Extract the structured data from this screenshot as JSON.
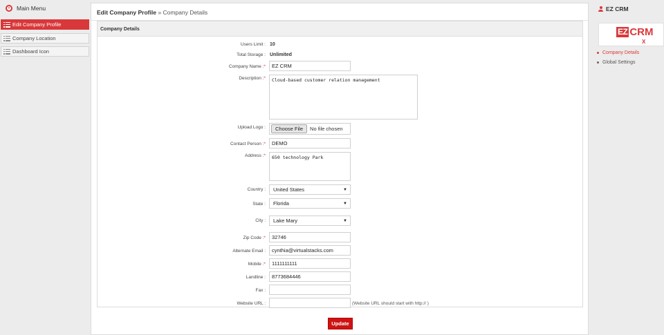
{
  "sidebar": {
    "menu_title": "Main Menu",
    "items": [
      {
        "label": "Edit Company Profile"
      },
      {
        "label": "Company Location"
      },
      {
        "label": "Dashboard Icon"
      }
    ]
  },
  "breadcrumb": {
    "current": "Edit Company Profile",
    "separator": "»",
    "sub": "Company Details"
  },
  "section": {
    "title": "Company Details"
  },
  "form": {
    "users_limit": {
      "label": "Users Limit :",
      "value": "10"
    },
    "total_storage": {
      "label": "Total Storage :",
      "value": "Unlimited"
    },
    "company_name": {
      "label": "Company Name :",
      "value": "EZ CRM"
    },
    "description": {
      "label": "Description :",
      "value": "Cloud-based customer relation management"
    },
    "upload_logo": {
      "label": "Upload Logo :",
      "button": "Choose File",
      "status": "No file chosen"
    },
    "contact_person": {
      "label": "Contact Person :",
      "value": "DEMO"
    },
    "address": {
      "label": "Address :",
      "value": "650 technology Park"
    },
    "country": {
      "label": "Country :",
      "value": "United States"
    },
    "state": {
      "label": "State :",
      "value": "Florida"
    },
    "city": {
      "label": "City :",
      "value": "Lake Mary"
    },
    "zip": {
      "label": "Zip Code :",
      "value": "32746"
    },
    "alt_email": {
      "label": "Alternate Email :",
      "value": "cynthia@virtualstacks.com"
    },
    "mobile": {
      "label": "Mobile :",
      "value": "1111111111"
    },
    "landline": {
      "label": "Landline :",
      "value": "8773684446"
    },
    "fax": {
      "label": "Fax :",
      "value": ""
    },
    "website": {
      "label": "Website URL :",
      "value": "",
      "hint": "(Website URL should start with http:// )"
    },
    "required_mark": "*",
    "update_label": "Update"
  },
  "right_panel": {
    "title": "EZ CRM",
    "logo_left": "EZ",
    "logo_right": "CRM",
    "logo_close": "X",
    "links": [
      {
        "label": "Company Details"
      },
      {
        "label": "Global Settings"
      }
    ]
  },
  "colors": {
    "accent": "#d9383a",
    "update_button": "#cc1414"
  },
  "icons": {
    "menu": "circle-chevron-down-icon",
    "list": "list-icon",
    "user": "user-icon",
    "dropdown": "caret-down-icon"
  }
}
